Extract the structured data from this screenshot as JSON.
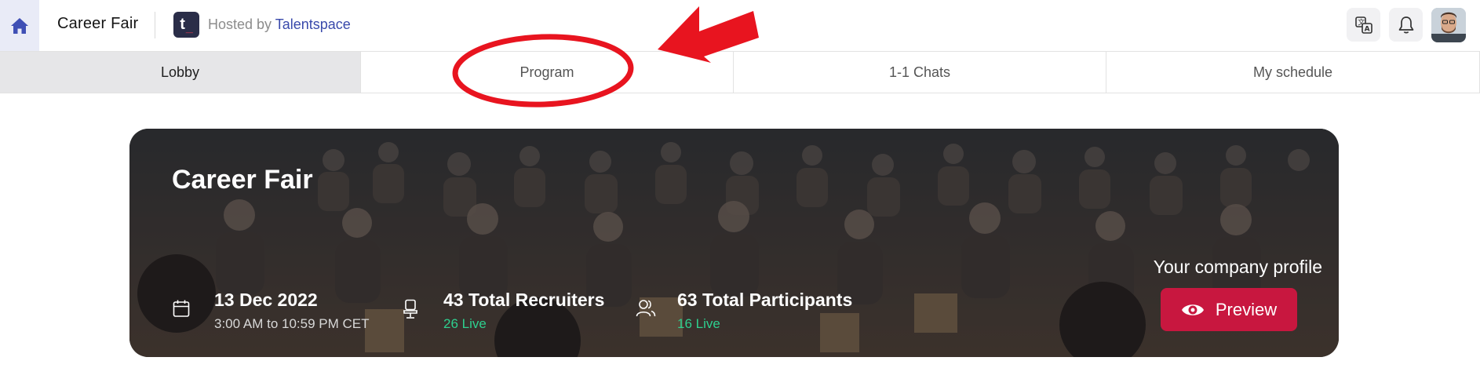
{
  "header": {
    "title": "Career Fair",
    "host_prefix": "Hosted by",
    "host_name": "Talentspace",
    "host_logo_text": "t",
    "host_logo_dot": "_"
  },
  "tabs": [
    {
      "label": "Lobby",
      "active": true
    },
    {
      "label": "Program",
      "active": false
    },
    {
      "label": "1-1 Chats",
      "active": false
    },
    {
      "label": "My schedule",
      "active": false
    }
  ],
  "banner": {
    "title": "Career Fair",
    "date": "13 Dec 2022",
    "time": "3:00 AM to 10:59 PM CET",
    "recruiters_total": "43 Total Recruiters",
    "recruiters_live": "26 Live",
    "participants_total": "63 Total Participants",
    "participants_live": "16 Live",
    "profile_label": "Your company profile",
    "preview_label": "Preview"
  },
  "icons": {
    "home": "home-icon",
    "translate": "translate-icon",
    "bell": "bell-icon",
    "calendar": "calendar-icon",
    "recruiter": "desk-chair-icon",
    "participants": "users-icon",
    "eye": "eye-icon"
  },
  "colors": {
    "accent": "#3949ab",
    "live": "#2ecf8f",
    "preview_button": "#c8173f",
    "annotation": "#e8141f"
  }
}
